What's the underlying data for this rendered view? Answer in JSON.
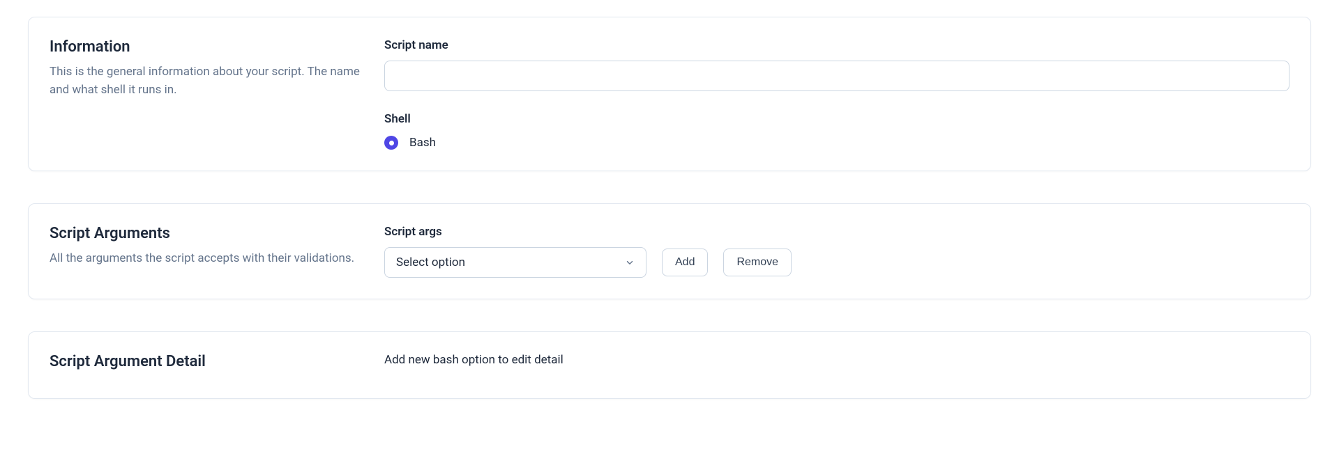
{
  "information": {
    "title": "Information",
    "description": "This is the general information about your script. The name and what shell it runs in.",
    "scriptNameLabel": "Script name",
    "scriptNameValue": "",
    "shellLabel": "Shell",
    "shellOption": "Bash"
  },
  "scriptArguments": {
    "title": "Script Arguments",
    "description": "All the arguments the script accepts with their validations.",
    "scriptArgsLabel": "Script args",
    "selectPlaceholder": "Select option",
    "addLabel": "Add",
    "removeLabel": "Remove"
  },
  "scriptArgumentDetail": {
    "title": "Script Argument Detail",
    "message": "Add new bash option to edit detail"
  }
}
